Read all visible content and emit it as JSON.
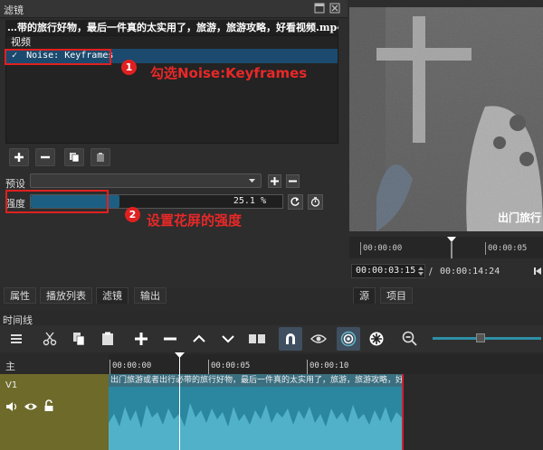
{
  "filters_panel": {
    "title": "滤镜",
    "clip_name": "…带的旅行好物，最后一件真的太实用了，旅游，旅游攻略，好看视频.mp4",
    "list_header": "视频",
    "filter_item": "Noise: Keyframes",
    "filter_checked": "✓",
    "preset_label": "预设",
    "strength_label": "强度",
    "strength_value": "25.1 %",
    "strength_fraction": 0.251
  },
  "annotations": {
    "step1_number": "1",
    "step1_text": "勾选Noise:Keyframes",
    "step2_number": "2",
    "step2_text": "设置花屏的强度"
  },
  "player": {
    "subtitle": "出门旅行",
    "ruler_ticks": [
      "00:00:00",
      "00:00:05"
    ],
    "current_time": "00:00:03:15",
    "separator": "/",
    "total_time": "00:00:14:24"
  },
  "bottom_tabs_left": [
    "属性",
    "播放列表",
    "滤镜",
    "输出"
  ],
  "bottom_tabs_right": [
    "源",
    "项目"
  ],
  "timeline": {
    "title": "时间线",
    "track_header_master": "主",
    "track_name": "V1",
    "ruler_ticks": [
      "00:00:00",
      "00:00:05",
      "00:00:10"
    ],
    "clip_title": "出门旅游或者出行必带的旅行好物，最后一件真的太实用了，旅游，旅游攻略，好"
  },
  "colors": {
    "accent_blue": "#1c4a6e",
    "annotation_red": "#e02020",
    "track_olive": "#6e6a2a",
    "audio_teal": "#2e8fa6"
  }
}
